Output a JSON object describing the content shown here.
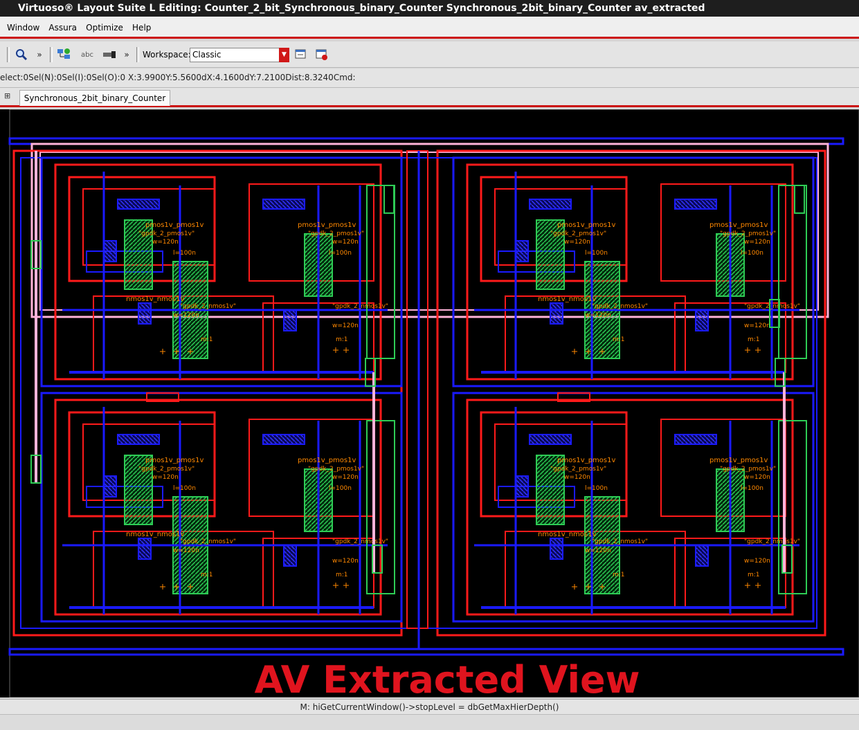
{
  "window": {
    "title": "Virtuoso® Layout Suite L Editing: Counter_2_bit_Synchronous_binary_Counter Synchronous_2bit_binary_Counter av_extracted"
  },
  "menu": {
    "items": [
      "Window",
      "Assura",
      "Optimize",
      "Help"
    ]
  },
  "toolbar": {
    "chevron": "»",
    "chevron2": "»",
    "workspace_label": "Workspace:",
    "workspace_value": "Classic",
    "abc_label": "abc"
  },
  "status": {
    "text": "elect:0Sel(N):0Sel(I):0Sel(O):0  X:3.9900Y:5.5600dX:4.1600dY:7.2100Dist:8.3240Cmd:"
  },
  "tab": {
    "label": "Synchronous_2bit_binary_Counter"
  },
  "canvas": {
    "overlay_title": "AV Extracted View",
    "device_labels": {
      "pmos": "pmos1v_pmos1v",
      "pmos_model": "\"gpdk_2_pmos1v\"",
      "nmos": "nmos1v_nmos1v",
      "nmos_model": "\"gpdk_2_nmos1v\"",
      "w": "w=120n",
      "l": "l=100n",
      "m": "m:1"
    },
    "colors": {
      "metal1": "#1a1aff",
      "poly": "#ff1a1a",
      "nwell": "#22cc66",
      "pink": "#ffb3d9",
      "label": "#ff8800"
    }
  },
  "bottom": {
    "command": "M: hiGetCurrentWindow()->stopLevel = dbGetMaxHierDepth()"
  }
}
